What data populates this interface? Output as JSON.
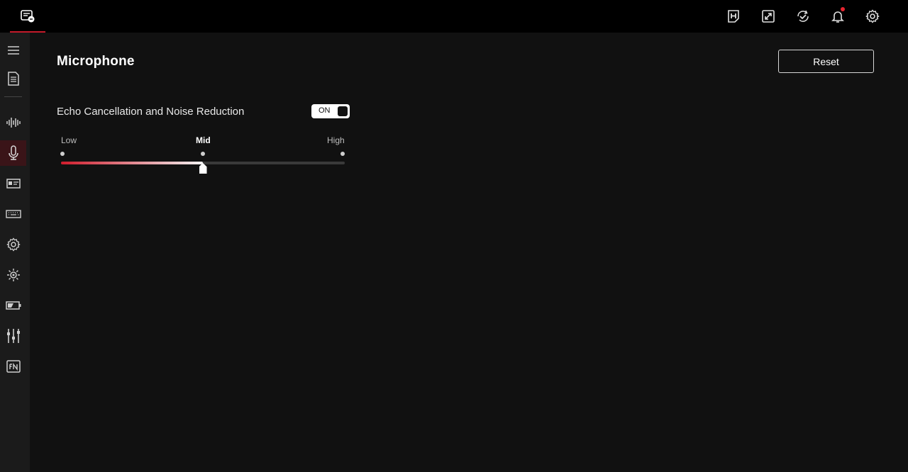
{
  "top_bar": {
    "icons": [
      "device-icon",
      "armoury-h-icon",
      "sync-screen-icon",
      "update-check-icon",
      "notification-bell-icon",
      "settings-gear-icon"
    ],
    "notification_dot_color": "#e8242f"
  },
  "sidebar": {
    "items": [
      "menu-icon",
      "document-icon",
      "audio-wave-icon",
      "microphone-icon",
      "display-icon",
      "keyboard-icon",
      "gear-icon",
      "lighting-icon",
      "battery-icon",
      "equalizer-icon",
      "fn-key-icon"
    ],
    "active": "microphone-icon"
  },
  "main": {
    "title": "Microphone",
    "reset_label": "Reset",
    "setting": {
      "label": "Echo Cancellation and Noise Reduction",
      "toggle_label": "ON"
    },
    "slider": {
      "labels": [
        "Low",
        "Mid",
        "High"
      ],
      "selected": "Mid",
      "value_fraction": 0.5
    }
  },
  "colors": {
    "accent": "#c41a2a",
    "background": "#111111",
    "sidebar": "#1b1b1b",
    "topbar": "#000000"
  }
}
